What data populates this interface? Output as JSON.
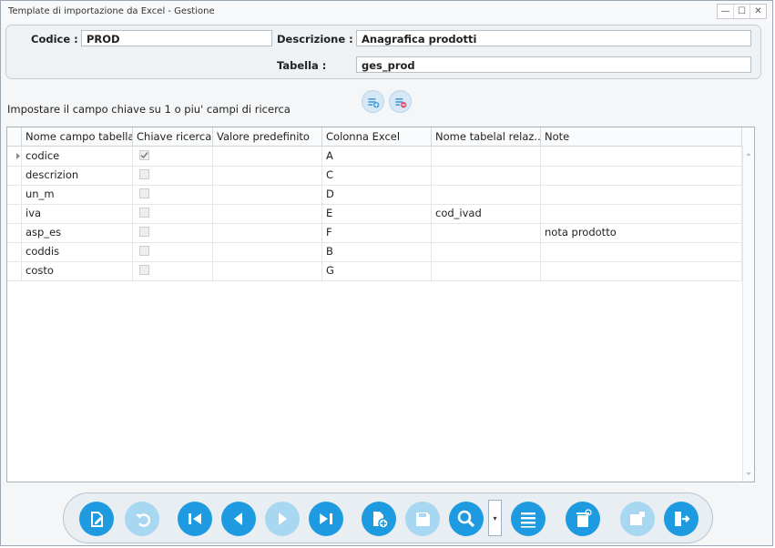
{
  "window": {
    "title": "Template di importazione da Excel - Gestione",
    "minimize": "—",
    "maximize": "☐",
    "close": "✕"
  },
  "header": {
    "codice_label": "Codice :",
    "codice_value": "PROD",
    "descrizione_label": "Descrizione :",
    "descrizione_value": "Anagrafica prodotti",
    "tabella_label": "Tabella :",
    "tabella_value": "ges_prod"
  },
  "hint": "Impostare il campo chiave su 1 o piu' campi di ricerca",
  "grid": {
    "columns": [
      "Nome campo tabella",
      "Chiave ricerca",
      "Valore predefinito",
      "Colonna Excel",
      "Nome tabelal relaz...",
      "Note"
    ],
    "rows": [
      {
        "nome": "codice",
        "chiave": true,
        "valore": "",
        "colonna": "A",
        "relaz": "",
        "note": ""
      },
      {
        "nome": "descrizion",
        "chiave": false,
        "valore": "",
        "colonna": "C",
        "relaz": "",
        "note": ""
      },
      {
        "nome": "un_m",
        "chiave": false,
        "valore": "",
        "colonna": "D",
        "relaz": "",
        "note": ""
      },
      {
        "nome": "iva",
        "chiave": false,
        "valore": "",
        "colonna": "E",
        "relaz": "cod_ivad",
        "note": ""
      },
      {
        "nome": "asp_es",
        "chiave": false,
        "valore": "",
        "colonna": "F",
        "relaz": "",
        "note": "nota prodotto"
      },
      {
        "nome": "coddis",
        "chiave": false,
        "valore": "",
        "colonna": "B",
        "relaz": "",
        "note": ""
      },
      {
        "nome": "costo",
        "chiave": false,
        "valore": "",
        "colonna": "G",
        "relaz": "",
        "note": ""
      }
    ]
  },
  "toolbar": {
    "buttons": [
      {
        "name": "edit",
        "enabled": true
      },
      {
        "name": "undo",
        "enabled": false
      },
      {
        "name": "first",
        "enabled": true
      },
      {
        "name": "previous",
        "enabled": true
      },
      {
        "name": "next",
        "enabled": false
      },
      {
        "name": "last",
        "enabled": true
      },
      {
        "name": "new",
        "enabled": true
      },
      {
        "name": "save",
        "enabled": false
      },
      {
        "name": "search",
        "enabled": true
      },
      {
        "name": "list",
        "enabled": true
      },
      {
        "name": "delete",
        "enabled": true
      },
      {
        "name": "open",
        "enabled": false
      },
      {
        "name": "exit",
        "enabled": true
      }
    ]
  },
  "colors": {
    "accent": "#1e9be0",
    "accent_disabled": "#a8d7f2"
  }
}
